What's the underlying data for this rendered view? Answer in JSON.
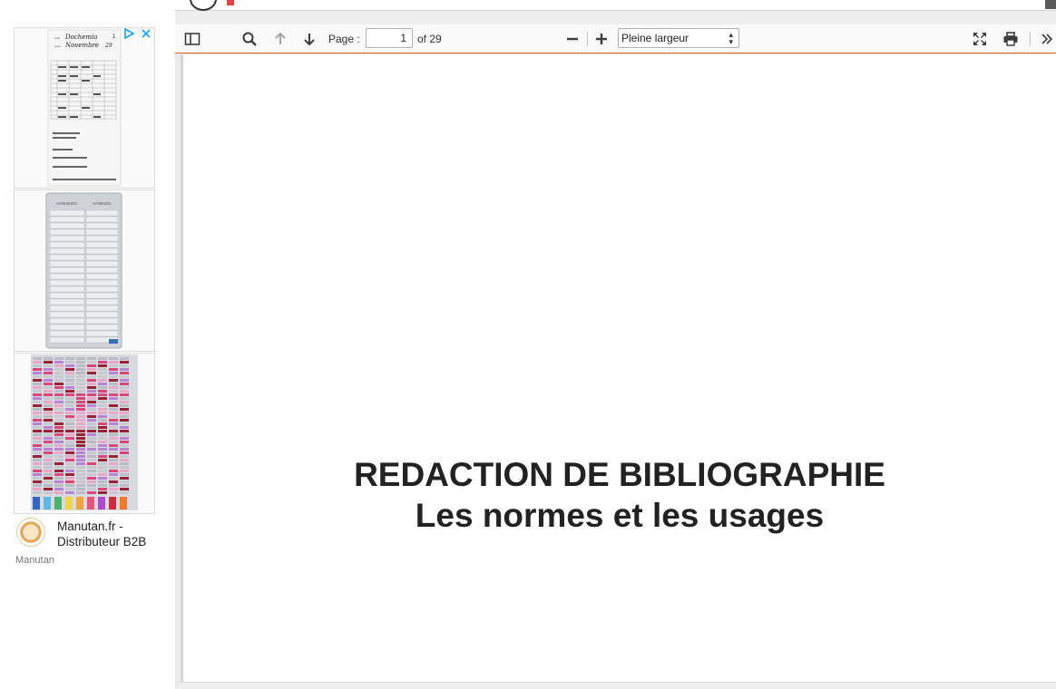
{
  "ad": {
    "choices_icon": "ad-choices-triangle",
    "close_icon": "close-x",
    "brand_name": "Manutan.fr - Distributeur B2B",
    "brand_sub": "Manutan",
    "thumb_1_handwriting_name": "Dochemia",
    "thumb_1_handwriting_month": "Novembre",
    "thumb_2_header_left": "AANHEZIG",
    "thumb_2_header_right": "AFWEZIG"
  },
  "toolbar": {
    "sidebar_icon": "sidebar-toggle-icon",
    "search_icon": "search-icon",
    "prev_icon": "arrow-up-icon",
    "next_icon": "arrow-down-icon",
    "page_label": "Page :",
    "page_value": "1",
    "page_total": "of 29",
    "zoom_out_icon": "minus-icon",
    "zoom_in_icon": "plus-icon",
    "zoom_value": "Pleine largeur",
    "fullscreen_icon": "fullscreen-icon",
    "print_icon": "print-icon",
    "more_icon": "double-chevron-icon"
  },
  "document": {
    "title_line1": "REDACTION DE BIBLIOGRAPHIE",
    "title_line2": "Les normes et les usages"
  },
  "colors": {
    "toolbar_accent": "#e66a2c",
    "ad_link": "#1da1f2"
  }
}
